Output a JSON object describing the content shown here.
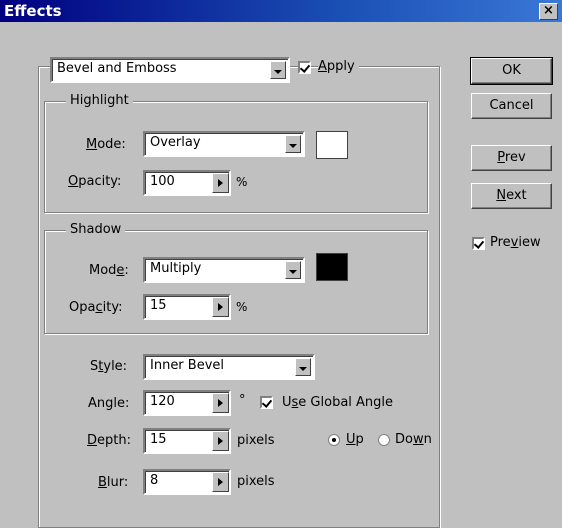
{
  "window": {
    "title": "Effects",
    "close_glyph": "×"
  },
  "effect_select": {
    "value": "Bevel and Emboss"
  },
  "apply": {
    "checked": true,
    "pre": "",
    "accel": "A",
    "post": "pply"
  },
  "buttons": {
    "ok": "OK",
    "cancel": "Cancel",
    "prev": {
      "accel": "P",
      "rest": "rev"
    },
    "next": {
      "accel": "N",
      "rest": "ext"
    }
  },
  "preview": {
    "checked": true,
    "pre": "Pre",
    "accel": "v",
    "post": "iew"
  },
  "highlight": {
    "legend": "Highlight",
    "mode_label": {
      "accel": "M",
      "rest": "ode:"
    },
    "mode_value": "Overlay",
    "opacity_label": {
      "accel": "O",
      "rest": "pacity:"
    },
    "opacity_value": "100",
    "unit": "%",
    "color": "#ffffff"
  },
  "shadow": {
    "legend": "Shadow",
    "mode_label": {
      "pre": "Mod",
      "accel": "e",
      "post": ":"
    },
    "mode_value": "Multiply",
    "opacity_label": {
      "pre": "Opa",
      "accel": "c",
      "post": "ity:"
    },
    "opacity_value": "15",
    "unit": "%",
    "color": "#000000"
  },
  "style_label": {
    "pre": "S",
    "accel": "t",
    "post": "yle:"
  },
  "style_value": "Inner Bevel",
  "angle_label": "Angle:",
  "angle_value": "120",
  "angle_unit": "°",
  "global_angle": {
    "checked": true,
    "pre": "U",
    "accel": "s",
    "post": "e Global Angle"
  },
  "depth_label": {
    "accel": "D",
    "rest": "epth:"
  },
  "depth_value": "15",
  "depth_unit": "pixels",
  "direction": {
    "up": {
      "pre": "",
      "accel": "U",
      "post": "p",
      "selected": true
    },
    "down": {
      "pre": "Do",
      "accel": "w",
      "post": "n",
      "selected": false
    }
  },
  "blur_label": {
    "accel": "B",
    "rest": "lur:"
  },
  "blur_value": "8",
  "blur_unit": "pixels"
}
